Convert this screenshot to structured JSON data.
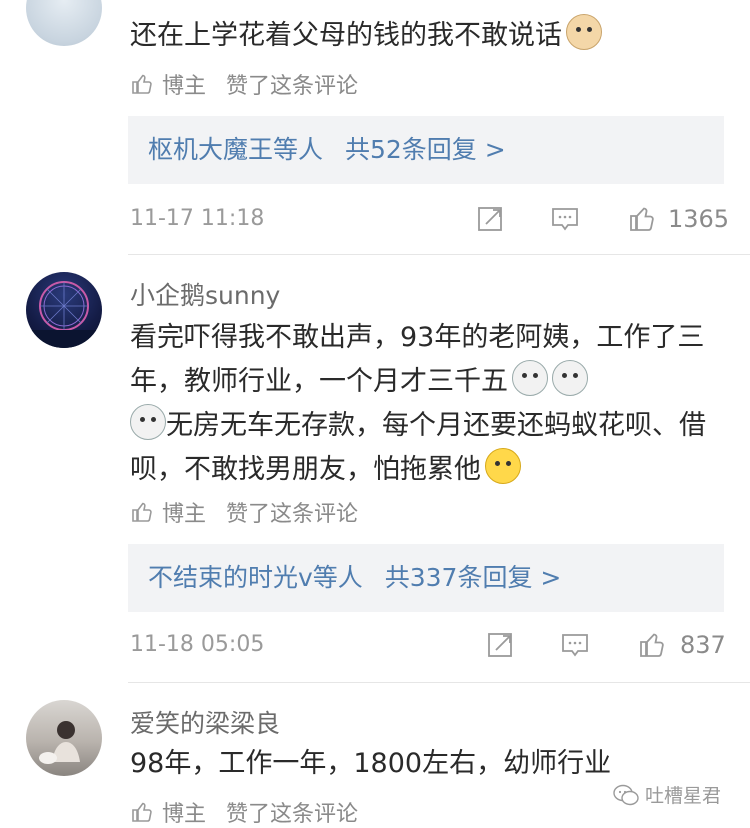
{
  "comments": [
    {
      "username": "",
      "text": "还在上学花着父母的钱的我不敢说话",
      "liked_by": "博主",
      "liked_label": "赞了这条评论",
      "replies_who": "枢机大魔王等人",
      "replies_count": "共52条回复 >",
      "time": "11-17 11:18",
      "likes": "1365"
    },
    {
      "username": "小企鹅sunny",
      "text": "看完吓得我不敢出声，93年的老阿姨，工作了三年，教师行业，一个月才三千五",
      "text2": "无房无车无存款，每个月还要还蚂蚁花呗、借呗，不敢找男朋友，怕拖累他",
      "liked_by": "博主",
      "liked_label": "赞了这条评论",
      "replies_who": "不结束的时光v等人",
      "replies_count": "共337条回复 >",
      "time": "11-18 05:05",
      "likes": "837"
    },
    {
      "username": "爱笑的梁梁良",
      "text": "98年，工作一年，1800左右，幼师行业",
      "liked_by": "博主",
      "liked_label": "赞了这条评论"
    }
  ],
  "watermark": "吐槽星君",
  "icons": {
    "like": "thumbs-up-icon",
    "share": "share-icon",
    "reply": "comment-icon"
  },
  "colors": {
    "link": "#507daf",
    "meta": "#8a8a8a",
    "reply_bg": "#f2f3f5"
  }
}
